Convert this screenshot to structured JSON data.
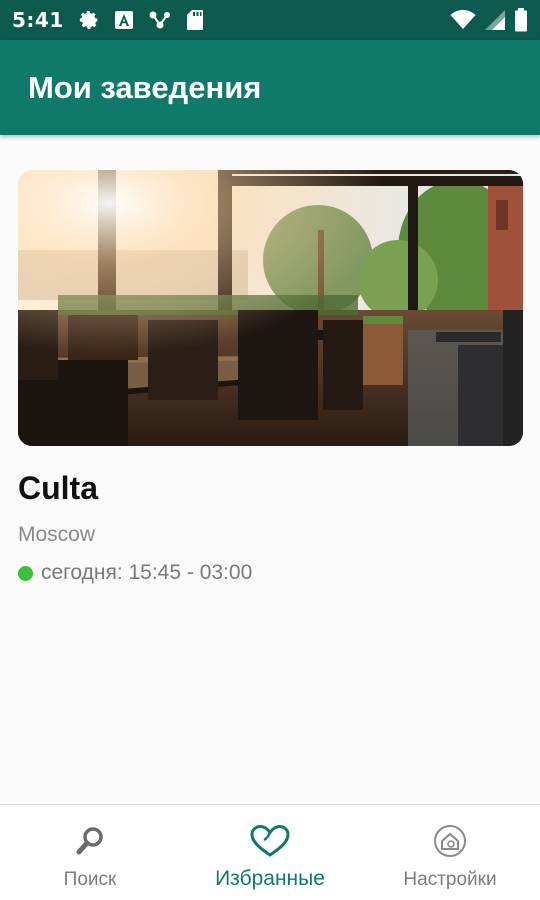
{
  "status_bar": {
    "time": "5:41",
    "icons_left": [
      "gear-icon",
      "a-box-icon",
      "share-nodes-icon",
      "sd-card-icon"
    ],
    "icons_right": [
      "wifi-icon",
      "cell-signal-icon",
      "battery-icon"
    ]
  },
  "app_bar": {
    "title": "Мои заведения"
  },
  "venues": [
    {
      "name": "Culta",
      "city": "Moscow",
      "hours": "сегодня: 15:45 - 03:00",
      "status_color": "#3cbf3a"
    }
  ],
  "bottom_nav": {
    "items": [
      {
        "label": "Поиск",
        "icon": "search-icon",
        "active": false
      },
      {
        "label": "Избранные",
        "icon": "heart-icon",
        "active": true
      },
      {
        "label": "Настройки",
        "icon": "home-settings-icon",
        "active": false
      }
    ]
  },
  "colors": {
    "status_bar": "#0c5a4e",
    "app_bar": "#0f7a69",
    "accent": "#0f7a69",
    "inactive": "#7d7d7d"
  }
}
